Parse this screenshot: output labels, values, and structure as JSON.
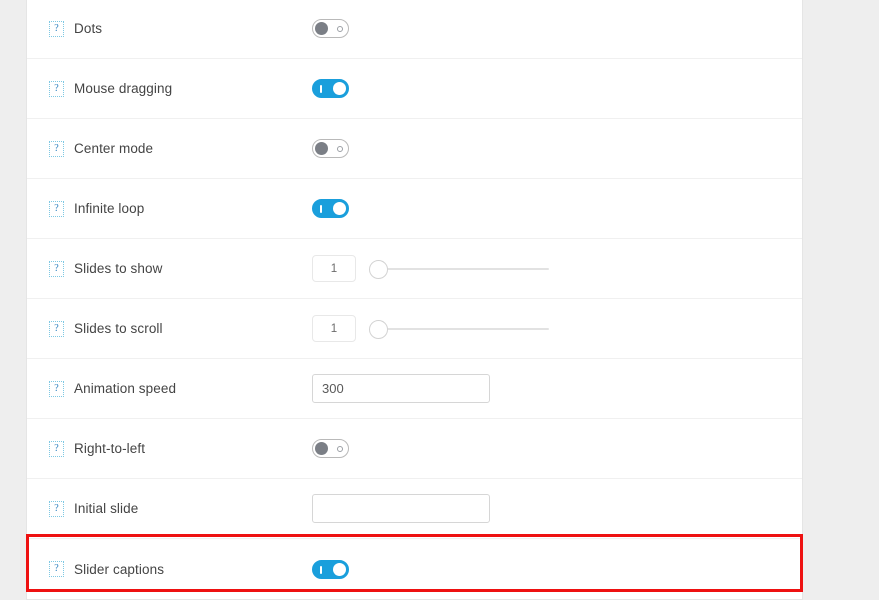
{
  "panel": {
    "name": "slider-settings-panel",
    "help_icon_glyph": "?",
    "rows": [
      {
        "label": "Dots",
        "control": "toggle",
        "state": "off"
      },
      {
        "label": "Mouse dragging",
        "control": "toggle",
        "state": "on"
      },
      {
        "label": "Center mode",
        "control": "toggle",
        "state": "off"
      },
      {
        "label": "Infinite loop",
        "control": "toggle",
        "state": "on"
      },
      {
        "label": "Slides to show",
        "control": "slider",
        "value": "1"
      },
      {
        "label": "Slides to scroll",
        "control": "slider",
        "value": "1"
      },
      {
        "label": "Animation speed",
        "control": "text",
        "value": "300",
        "placeholder": ""
      },
      {
        "label": "Right-to-left",
        "control": "toggle",
        "state": "off"
      },
      {
        "label": "Initial slide",
        "control": "text",
        "value": "",
        "placeholder": ""
      },
      {
        "label": "Slider captions",
        "control": "toggle",
        "state": "on",
        "highlighted": true
      }
    ]
  },
  "annotation": {
    "type": "rectangle",
    "color": "#ee1111",
    "targets_row_label": "Slider captions"
  },
  "colors": {
    "accent_blue": "#1a9fdc",
    "help_icon_blue": "#2a7fbd",
    "label_text": "#444444",
    "row_divider": "#f0f0f0",
    "panel_background": "#ffffff",
    "page_background": "#eeeeee",
    "highlight_red": "#ee1111"
  }
}
